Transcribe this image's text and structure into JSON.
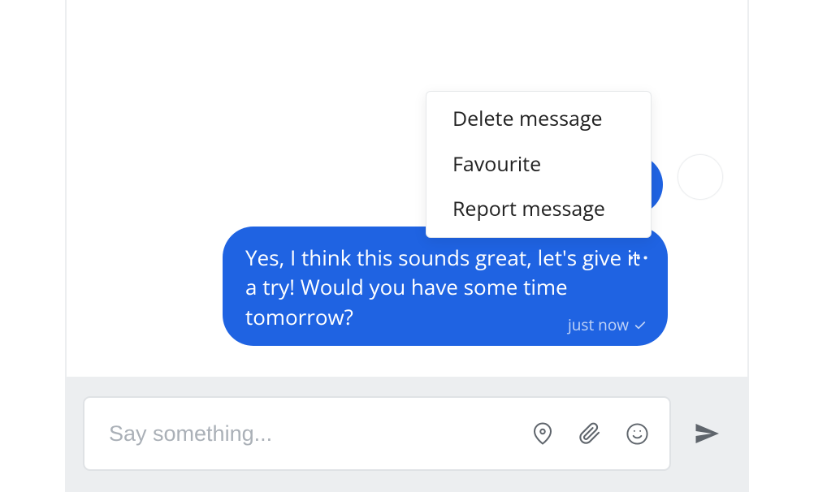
{
  "context_menu": {
    "items": [
      {
        "label": "Delete message"
      },
      {
        "label": "Favourite"
      },
      {
        "label": "Report message"
      }
    ]
  },
  "messages": {
    "bubble2": {
      "text": "Yes, I think this sounds great, let's give it a try! Would you have some time tomorrow?",
      "timestamp": "just now"
    }
  },
  "composer": {
    "placeholder": "Say something..."
  }
}
